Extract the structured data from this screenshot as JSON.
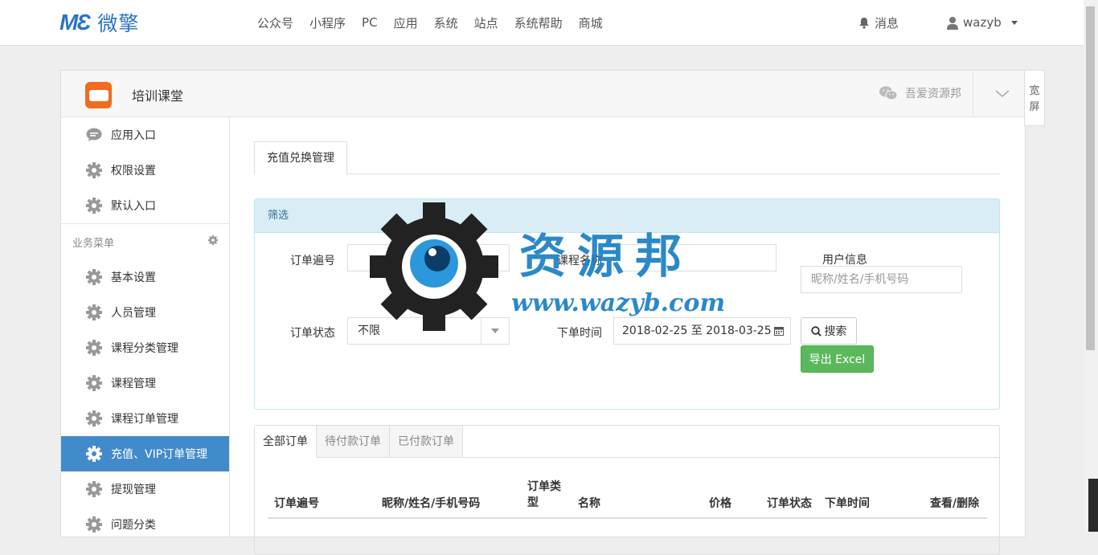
{
  "topbar": {
    "logo_mark": "MƐ",
    "logo_text": "微擎",
    "nav": [
      "公众号",
      "小程序",
      "PC",
      "应用",
      "系统",
      "站点",
      "系统帮助",
      "商城"
    ],
    "messages": "消息",
    "username": "wazyb"
  },
  "panel": {
    "app_title": "培训课堂",
    "account": "吾爱资源邦",
    "wide_label": "宽屏"
  },
  "sidebar": {
    "top_items": [
      "应用入口",
      "权限设置",
      "默认入口"
    ],
    "section_title": "业务菜单",
    "items": [
      "基本设置",
      "人员管理",
      "课程分类管理",
      "课程管理",
      "课程订单管理",
      "充值、VIP订单管理",
      "提现管理",
      "问题分类"
    ],
    "active_index": 5
  },
  "content": {
    "tab": "充值兑换管理",
    "filter": {
      "title": "筛选",
      "order_no_label": "订单遍号",
      "course_name_label": "课程名称",
      "user_info_label": "用户信息",
      "user_info_placeholder": "昵称/姓名/手机号码",
      "status_label": "订单状态",
      "status_value": "不限",
      "time_label": "下单时间",
      "time_value": "2018-02-25 至 2018-03-25",
      "search_button": "搜索",
      "export_button": "导出 Excel"
    },
    "orders": {
      "tabs": [
        "全部订单",
        "待付款订单",
        "已付款订单"
      ],
      "columns": [
        "订单遍号",
        "昵称/姓名/手机号码",
        "订单类型",
        "名称",
        "价格",
        "订单状态",
        "下单时间",
        "查看/删除"
      ]
    }
  },
  "watermark": {
    "title": "资源邦",
    "url": "www.wazyb.com"
  },
  "colors": {
    "brand": "#2a74c3",
    "active": "#428bca",
    "success": "#5cb85c",
    "info_bg": "#d9edf7"
  }
}
